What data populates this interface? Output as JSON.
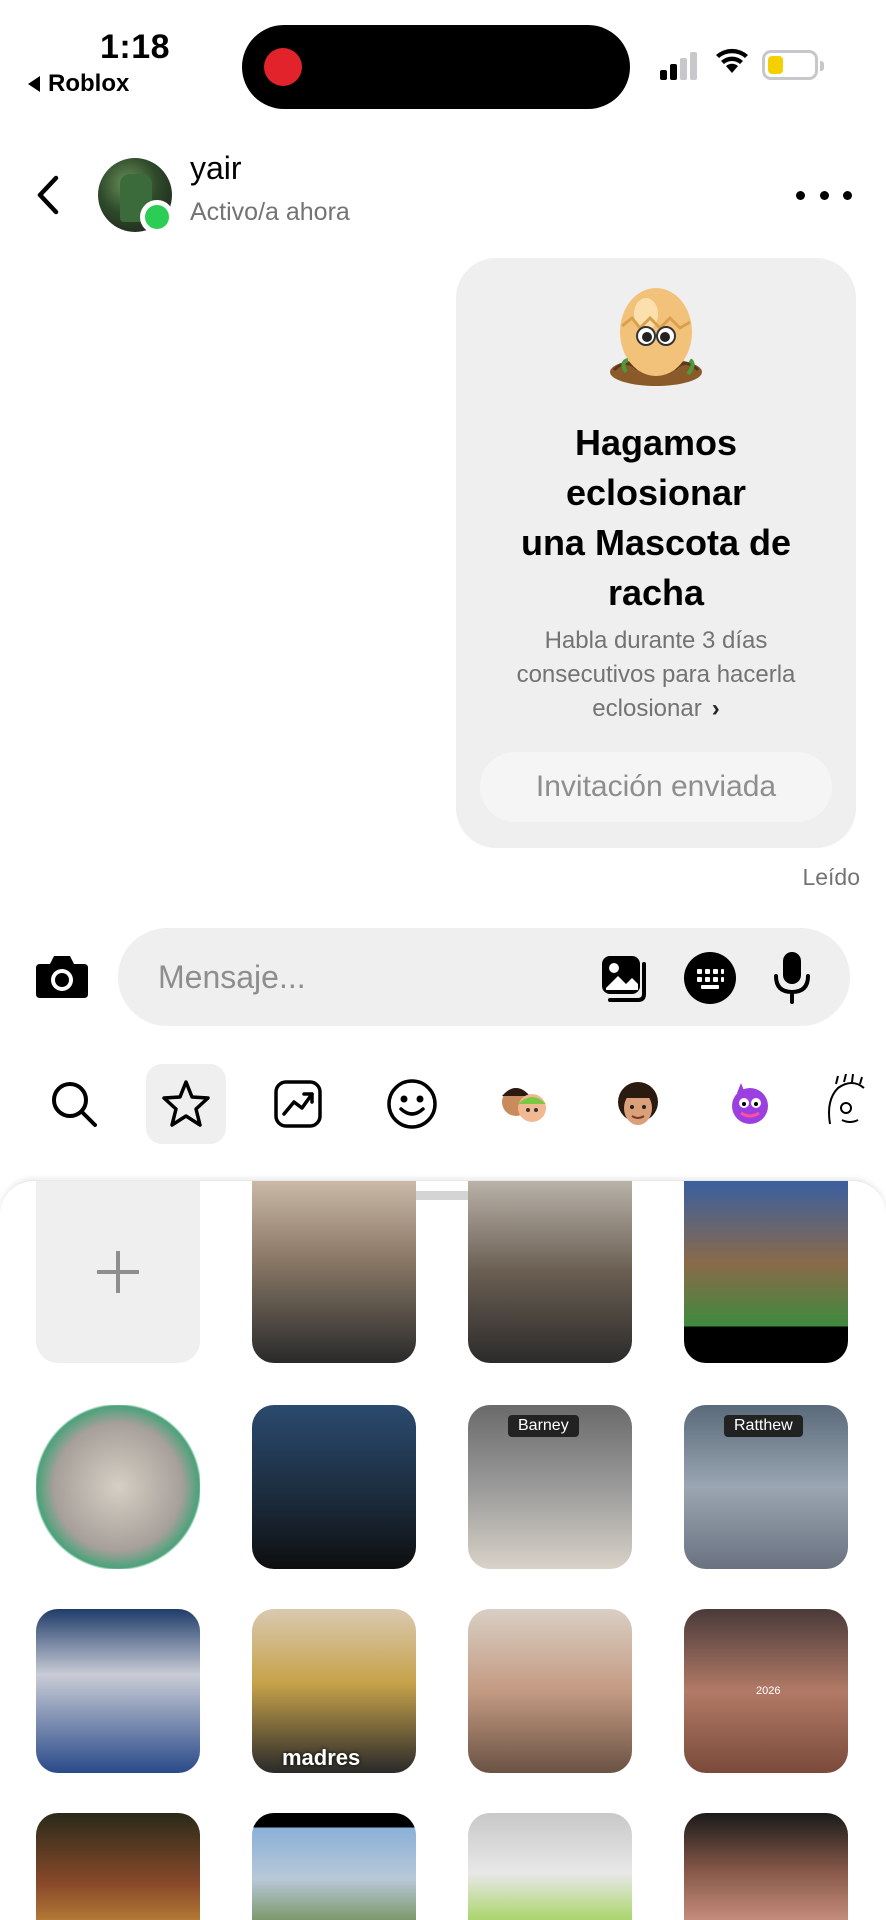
{
  "status_bar": {
    "time": "1:18",
    "back_app_label": "Roblox",
    "battery_color": "#f4d000",
    "recording_color": "#e3232b"
  },
  "chat_header": {
    "user_name": "yair",
    "user_status": "Activo/a ahora",
    "back_icon": "chevron-left-icon",
    "more_icon": "more-horizontal-icon",
    "online_color": "#2ccd55"
  },
  "streak_card": {
    "icon": "egg-pet-icon",
    "title_lines": [
      "Hagamos",
      "eclosionar",
      "una Mascota de",
      "racha"
    ],
    "description_lines": [
      "Habla durante 3 días",
      "consecutivos para hacerla",
      "eclosionar"
    ],
    "button_label": "Invitación enviada"
  },
  "read_receipt": "Leído",
  "composer": {
    "placeholder": "Mensaje...",
    "icons": [
      "camera-icon",
      "gallery-icon",
      "sticker-keyboard-icon",
      "microphone-icon"
    ]
  },
  "sticker_tabs": [
    {
      "name": "search-icon",
      "active": false
    },
    {
      "name": "star-icon",
      "active": true
    },
    {
      "name": "trending-icon",
      "active": false
    },
    {
      "name": "emoji-icon",
      "active": false
    },
    {
      "name": "avatar-pair-icon",
      "active": false
    },
    {
      "name": "avatar-face-icon",
      "active": false
    },
    {
      "name": "purple-monster-icon",
      "active": false
    },
    {
      "name": "sketch-face-icon",
      "active": false
    }
  ],
  "sticker_grid": {
    "add_icon": "plus-icon",
    "tiles": [
      {
        "label": ""
      },
      {
        "label": ""
      },
      {
        "label": ""
      },
      {
        "label": ""
      },
      {
        "label": ""
      },
      {
        "label": "Barney"
      },
      {
        "label": "Ratthew"
      },
      {
        "label": ""
      },
      {
        "label": "madres"
      },
      {
        "label": ""
      },
      {
        "label": "2026"
      },
      {
        "label": ""
      },
      {
        "label": ""
      },
      {
        "label": ""
      },
      {
        "label": ""
      }
    ]
  }
}
